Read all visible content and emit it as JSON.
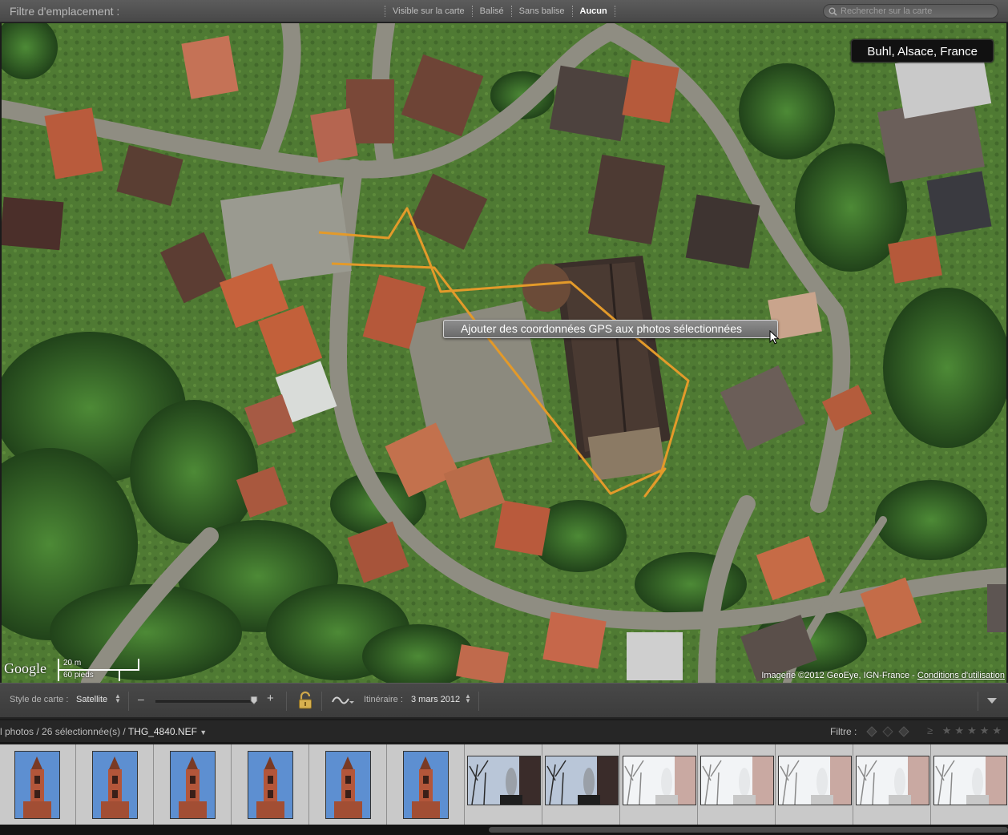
{
  "filter_bar": {
    "title": "Filtre d'emplacement :",
    "options": [
      {
        "label": "Visible sur la carte",
        "active": false
      },
      {
        "label": "Balisé",
        "active": false
      },
      {
        "label": "Sans balise",
        "active": false
      },
      {
        "label": "Aucun",
        "active": true
      }
    ],
    "search_placeholder": "Rechercher sur la carte"
  },
  "map": {
    "location": "Buhl, Alsace, France",
    "tooltip": "Ajouter des coordonnées GPS aux photos sélectionnées",
    "logo": "Google",
    "scale_metric": "20 m",
    "scale_imperial": "60 pieds",
    "attribution": "Imagerie ©2012 GeoEye, IGN-France - ",
    "terms_link": "Conditions d'utilisation",
    "track_color": "#e39a2a"
  },
  "toolbar": {
    "map_style_label": "Style de carte :",
    "map_style_value": "Satellite",
    "itinerary_label": "Itinéraire :",
    "itinerary_value": "3 mars 2012",
    "zoom_minus": "–",
    "zoom_plus": "+"
  },
  "filmstrip_header": {
    "count_prefix": "l photos / 26 sélectionnée(s) / ",
    "current_file": "THG_4840.NEF",
    "filter_label": "Filtre :",
    "rating_prefix": "≥"
  },
  "filmstrip": {
    "thumbnails": [
      {
        "name": "church-tower",
        "orientation": "portrait",
        "selected": true
      },
      {
        "name": "church-tower",
        "orientation": "portrait",
        "selected": true
      },
      {
        "name": "church-tower",
        "orientation": "portrait",
        "selected": true
      },
      {
        "name": "church-tower",
        "orientation": "portrait",
        "selected": true
      },
      {
        "name": "church-tower",
        "orientation": "portrait",
        "selected": true
      },
      {
        "name": "church-tower",
        "orientation": "portrait",
        "selected": true
      },
      {
        "name": "statue-dark",
        "orientation": "landscape",
        "selected": true
      },
      {
        "name": "statue-dark",
        "orientation": "landscape",
        "selected": true
      },
      {
        "name": "statue-bright",
        "orientation": "landscape",
        "selected": true
      },
      {
        "name": "statue-bright",
        "orientation": "landscape",
        "selected": true
      },
      {
        "name": "statue-bright",
        "orientation": "landscape",
        "selected": true
      },
      {
        "name": "statue-bright",
        "orientation": "landscape",
        "selected": true
      },
      {
        "name": "statue-bright",
        "orientation": "landscape",
        "selected": true
      }
    ]
  }
}
